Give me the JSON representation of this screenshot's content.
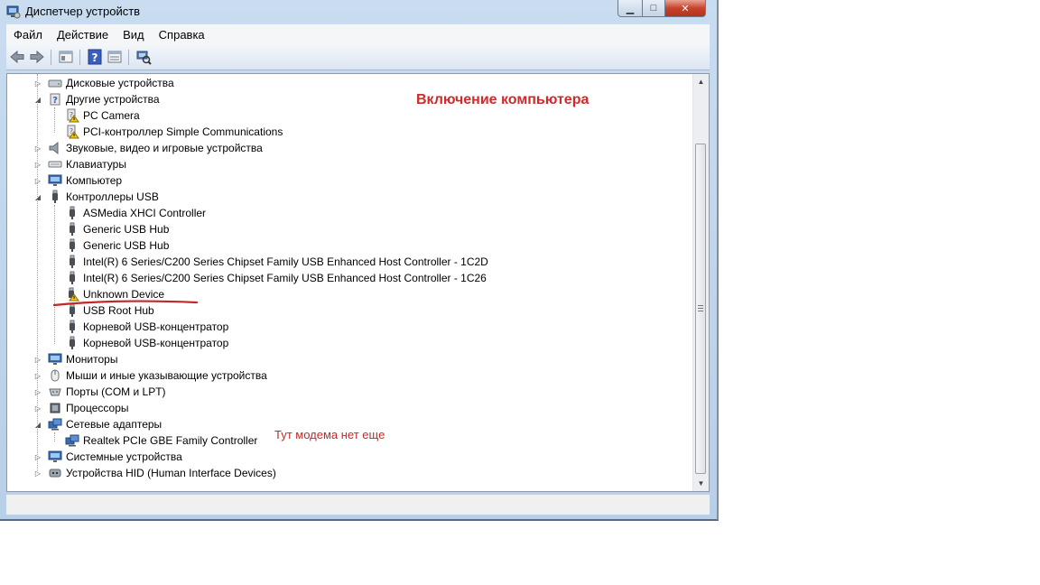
{
  "window": {
    "title": "Диспетчер устройств"
  },
  "menu": [
    "Файл",
    "Действие",
    "Вид",
    "Справка"
  ],
  "toolbar_icons": [
    "back-arrow-icon",
    "forward-arrow-icon",
    "properties-view-icon",
    "help-icon",
    "details-icon",
    "scan-hardware-icon"
  ],
  "tree": [
    {
      "level": 0,
      "label": "Дисковые устройства",
      "icon": "disk-icon",
      "state": "collapsed"
    },
    {
      "level": 0,
      "label": "Другие устройства",
      "icon": "unknown-device-icon",
      "state": "expanded"
    },
    {
      "level": 1,
      "label": "PC Camera",
      "icon": "warning-device-icon"
    },
    {
      "level": 1,
      "label": "PCI-контроллер Simple Communications",
      "icon": "warning-device-icon"
    },
    {
      "level": 0,
      "label": "Звуковые, видео и игровые устройства",
      "icon": "speaker-icon",
      "state": "collapsed"
    },
    {
      "level": 0,
      "label": "Клавиатуры",
      "icon": "keyboard-icon",
      "state": "collapsed"
    },
    {
      "level": 0,
      "label": "Компьютер",
      "icon": "monitor-icon",
      "state": "collapsed"
    },
    {
      "level": 0,
      "label": "Контроллеры USB",
      "icon": "usb-icon",
      "state": "expanded"
    },
    {
      "level": 1,
      "label": "ASMedia XHCI Controller",
      "icon": "usb-icon"
    },
    {
      "level": 1,
      "label": "Generic USB Hub",
      "icon": "usb-icon"
    },
    {
      "level": 1,
      "label": "Generic USB Hub",
      "icon": "usb-icon"
    },
    {
      "level": 1,
      "label": "Intel(R) 6 Series/C200 Series Chipset Family USB Enhanced Host Controller - 1C2D",
      "icon": "usb-icon"
    },
    {
      "level": 1,
      "label": "Intel(R) 6 Series/C200 Series Chipset Family USB Enhanced Host Controller - 1C26",
      "icon": "usb-icon"
    },
    {
      "level": 1,
      "label": "Unknown Device",
      "icon": "usb-warning-icon"
    },
    {
      "level": 1,
      "label": "USB Root Hub",
      "icon": "usb-icon"
    },
    {
      "level": 1,
      "label": "Корневой USB-концентратор",
      "icon": "usb-icon"
    },
    {
      "level": 1,
      "label": "Корневой USB-концентратор",
      "icon": "usb-icon"
    },
    {
      "level": 0,
      "label": "Мониторы",
      "icon": "monitor-icon",
      "state": "collapsed"
    },
    {
      "level": 0,
      "label": "Мыши и иные указывающие устройства",
      "icon": "mouse-icon",
      "state": "collapsed"
    },
    {
      "level": 0,
      "label": "Порты (COM и LPT)",
      "icon": "port-icon",
      "state": "collapsed"
    },
    {
      "level": 0,
      "label": "Процессоры",
      "icon": "cpu-icon",
      "state": "collapsed"
    },
    {
      "level": 0,
      "label": "Сетевые адаптеры",
      "icon": "network-icon",
      "state": "expanded"
    },
    {
      "level": 1,
      "label": "Realtek PCIe GBE Family Controller",
      "icon": "network-icon"
    },
    {
      "level": 0,
      "label": "Системные устройства",
      "icon": "monitor-icon",
      "state": "collapsed"
    },
    {
      "level": 0,
      "label": "Устройства HID (Human Interface Devices)",
      "icon": "hid-icon",
      "state": "collapsed"
    }
  ],
  "annotations": {
    "title": "Включение компьютера",
    "note": "Тут модема нет еще"
  },
  "colors": {
    "annotation_red": "#d2292b"
  }
}
